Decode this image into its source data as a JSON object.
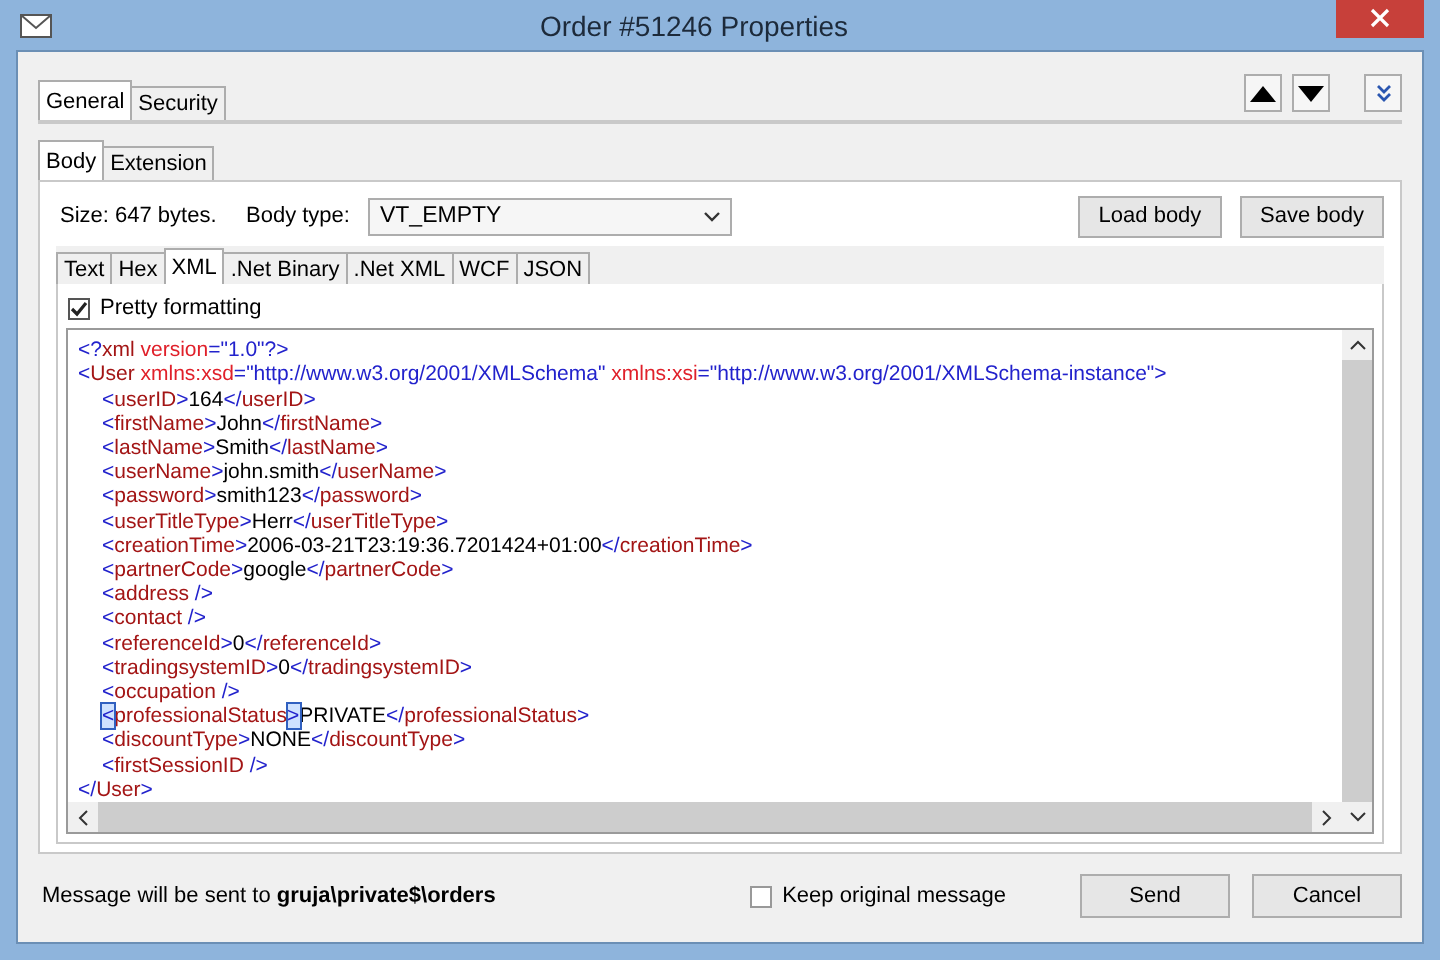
{
  "window": {
    "title": "Order #51246 Properties"
  },
  "top_tabs": [
    {
      "label": "General",
      "selected": true
    },
    {
      "label": "Security",
      "selected": false
    }
  ],
  "body_tabs": [
    {
      "label": "Body",
      "selected": true
    },
    {
      "label": "Extension",
      "selected": false
    }
  ],
  "size_label": "Size: 647 bytes.",
  "body_type": {
    "label": "Body type:",
    "value": "VT_EMPTY"
  },
  "body_buttons": [
    "Load body",
    "Save body"
  ],
  "format_tabs": [
    {
      "label": "Text",
      "selected": false
    },
    {
      "label": "Hex",
      "selected": false
    },
    {
      "label": "XML",
      "selected": true
    },
    {
      "label": ".Net Binary",
      "selected": false
    },
    {
      "label": ".Net XML",
      "selected": false
    },
    {
      "label": "WCF",
      "selected": false
    },
    {
      "label": "JSON",
      "selected": false
    }
  ],
  "pretty_formatting": {
    "label": "Pretty formatting",
    "checked": true
  },
  "xml_lines": [
    {
      "segments": [
        {
          "kind": "punct",
          "text": "<?"
        },
        {
          "kind": "tag",
          "text": "xml "
        },
        {
          "kind": "attr",
          "text": "version"
        },
        {
          "kind": "punct",
          "text": "="
        },
        {
          "kind": "value",
          "text": "\"1.0\""
        },
        {
          "kind": "punct",
          "text": "?>"
        }
      ]
    },
    {
      "segments": [
        {
          "kind": "punct",
          "text": "<"
        },
        {
          "kind": "tag",
          "text": "User "
        },
        {
          "kind": "attr",
          "text": "xmlns:xsd"
        },
        {
          "kind": "punct",
          "text": "="
        },
        {
          "kind": "value",
          "text": "\"http://www.w3.org/2001/XMLSchema\" "
        },
        {
          "kind": "attr",
          "text": "xmlns:xsi"
        },
        {
          "kind": "punct",
          "text": "="
        },
        {
          "kind": "value",
          "text": "\"http://www.w3.org/2001/XMLSchema-instance\""
        },
        {
          "kind": "punct",
          "text": ">"
        }
      ],
      "children": [
        {
          "segments": [
            {
              "kind": "punct",
              "text": "<"
            },
            {
              "kind": "tag",
              "text": "userID"
            },
            {
              "kind": "punct",
              "text": ">"
            },
            {
              "kind": "text",
              "text": "164"
            },
            {
              "kind": "punct",
              "text": "</"
            },
            {
              "kind": "tag",
              "text": "userID"
            },
            {
              "kind": "punct",
              "text": ">"
            }
          ]
        },
        {
          "segments": [
            {
              "kind": "punct",
              "text": "<"
            },
            {
              "kind": "tag",
              "text": "firstName"
            },
            {
              "kind": "punct",
              "text": ">"
            },
            {
              "kind": "text",
              "text": "John"
            },
            {
              "kind": "punct",
              "text": "</"
            },
            {
              "kind": "tag",
              "text": "firstName"
            },
            {
              "kind": "punct",
              "text": ">"
            }
          ]
        },
        {
          "segments": [
            {
              "kind": "punct",
              "text": "<"
            },
            {
              "kind": "tag",
              "text": "lastName"
            },
            {
              "kind": "punct",
              "text": ">"
            },
            {
              "kind": "text",
              "text": "Smith"
            },
            {
              "kind": "punct",
              "text": "</"
            },
            {
              "kind": "tag",
              "text": "lastName"
            },
            {
              "kind": "punct",
              "text": ">"
            }
          ]
        },
        {
          "segments": [
            {
              "kind": "punct",
              "text": "<"
            },
            {
              "kind": "tag",
              "text": "userName"
            },
            {
              "kind": "punct",
              "text": ">"
            },
            {
              "kind": "text",
              "text": "john.smith"
            },
            {
              "kind": "punct",
              "text": "</"
            },
            {
              "kind": "tag",
              "text": "userName"
            },
            {
              "kind": "punct",
              "text": ">"
            }
          ]
        },
        {
          "segments": [
            {
              "kind": "punct",
              "text": "<"
            },
            {
              "kind": "tag",
              "text": "password"
            },
            {
              "kind": "punct",
              "text": ">"
            },
            {
              "kind": "text",
              "text": "smith123"
            },
            {
              "kind": "punct",
              "text": "</"
            },
            {
              "kind": "tag",
              "text": "password"
            },
            {
              "kind": "punct",
              "text": ">"
            }
          ]
        },
        {
          "segments": [
            {
              "kind": "punct",
              "text": "<"
            },
            {
              "kind": "tag",
              "text": "userTitleType"
            },
            {
              "kind": "punct",
              "text": ">"
            },
            {
              "kind": "text",
              "text": "Herr"
            },
            {
              "kind": "punct",
              "text": "</"
            },
            {
              "kind": "tag",
              "text": "userTitleType"
            },
            {
              "kind": "punct",
              "text": ">"
            }
          ]
        },
        {
          "segments": [
            {
              "kind": "punct",
              "text": "<"
            },
            {
              "kind": "tag",
              "text": "creationTime"
            },
            {
              "kind": "punct",
              "text": ">"
            },
            {
              "kind": "text",
              "text": "2006-03-21T23:19:36.7201424+01:00"
            },
            {
              "kind": "punct",
              "text": "</"
            },
            {
              "kind": "tag",
              "text": "creationTime"
            },
            {
              "kind": "punct",
              "text": ">"
            }
          ]
        },
        {
          "segments": [
            {
              "kind": "punct",
              "text": "<"
            },
            {
              "kind": "tag",
              "text": "partnerCode"
            },
            {
              "kind": "punct",
              "text": ">"
            },
            {
              "kind": "text",
              "text": "google"
            },
            {
              "kind": "punct",
              "text": "</"
            },
            {
              "kind": "tag",
              "text": "partnerCode"
            },
            {
              "kind": "punct",
              "text": ">"
            }
          ]
        },
        {
          "segments": [
            {
              "kind": "punct",
              "text": "<"
            },
            {
              "kind": "tag",
              "text": "address "
            },
            {
              "kind": "punct",
              "text": "/>"
            }
          ]
        },
        {
          "segments": [
            {
              "kind": "punct",
              "text": "<"
            },
            {
              "kind": "tag",
              "text": "contact "
            },
            {
              "kind": "punct",
              "text": "/>"
            }
          ]
        },
        {
          "segments": [
            {
              "kind": "punct",
              "text": "<"
            },
            {
              "kind": "tag",
              "text": "referenceId"
            },
            {
              "kind": "punct",
              "text": ">"
            },
            {
              "kind": "text",
              "text": "0"
            },
            {
              "kind": "punct",
              "text": "</"
            },
            {
              "kind": "tag",
              "text": "referenceId"
            },
            {
              "kind": "punct",
              "text": ">"
            }
          ]
        },
        {
          "segments": [
            {
              "kind": "punct",
              "text": "<"
            },
            {
              "kind": "tag",
              "text": "tradingsystemID"
            },
            {
              "kind": "punct",
              "text": ">"
            },
            {
              "kind": "text",
              "text": "0"
            },
            {
              "kind": "punct",
              "text": "</"
            },
            {
              "kind": "tag",
              "text": "tradingsystemID"
            },
            {
              "kind": "punct",
              "text": ">"
            }
          ]
        },
        {
          "segments": [
            {
              "kind": "punct",
              "text": "<"
            },
            {
              "kind": "tag",
              "text": "occupation "
            },
            {
              "kind": "punct",
              "text": "/>"
            }
          ]
        },
        {
          "segments": [
            {
              "kind": "match",
              "text": "<"
            },
            {
              "kind": "tag",
              "text": "professionalStatus"
            },
            {
              "kind": "match",
              "text": ">"
            },
            {
              "kind": "text",
              "text": "PRIVATE"
            },
            {
              "kind": "punct",
              "text": "</"
            },
            {
              "kind": "tag",
              "text": "professionalStatus"
            },
            {
              "kind": "punct",
              "text": ">"
            }
          ]
        },
        {
          "segments": [
            {
              "kind": "punct",
              "text": "<"
            },
            {
              "kind": "tag",
              "text": "discountType"
            },
            {
              "kind": "punct",
              "text": ">"
            },
            {
              "kind": "text",
              "text": "NONE"
            },
            {
              "kind": "punct",
              "text": "</"
            },
            {
              "kind": "tag",
              "text": "discountType"
            },
            {
              "kind": "punct",
              "text": ">"
            }
          ]
        },
        {
          "segments": [
            {
              "kind": "punct",
              "text": "<"
            },
            {
              "kind": "tag",
              "text": "firstSessionID "
            },
            {
              "kind": "punct",
              "text": "/>"
            }
          ]
        }
      ]
    },
    {
      "segments": [
        {
          "kind": "punct",
          "text": "</"
        },
        {
          "kind": "tag",
          "text": "User"
        },
        {
          "kind": "punct",
          "text": ">"
        }
      ]
    }
  ],
  "status": {
    "prefix": "Message will be sent to ",
    "queue": "gruja\\private$\\orders"
  },
  "keep_original": {
    "label": "Keep original message",
    "checked": false
  },
  "buttons": [
    "Send",
    "Cancel"
  ]
}
